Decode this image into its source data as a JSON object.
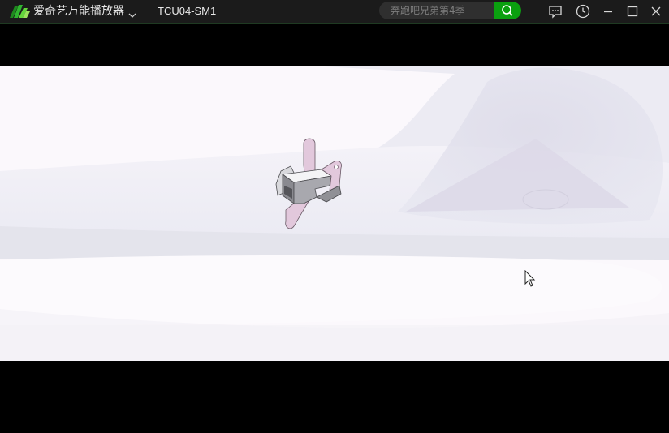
{
  "titlebar": {
    "app_name": "爱奇艺万能播放器",
    "video_title": "TCU04-SM1",
    "search_placeholder": "奔跑吧兄弟第4季"
  },
  "icons": {
    "logo": "iqiyi-logo-icon",
    "app_menu": "chevron-down-icon",
    "search": "search-icon",
    "feedback": "chat-bubble-icon",
    "history": "clock-icon",
    "minimize": "minimize-icon",
    "maximize": "maximize-icon",
    "close": "close-icon"
  },
  "colors": {
    "accent": "#0aa00f",
    "titlebar_bg": "#1b1b1b",
    "video_bg": "#fbf8fc",
    "part": "#e2c8dc"
  }
}
